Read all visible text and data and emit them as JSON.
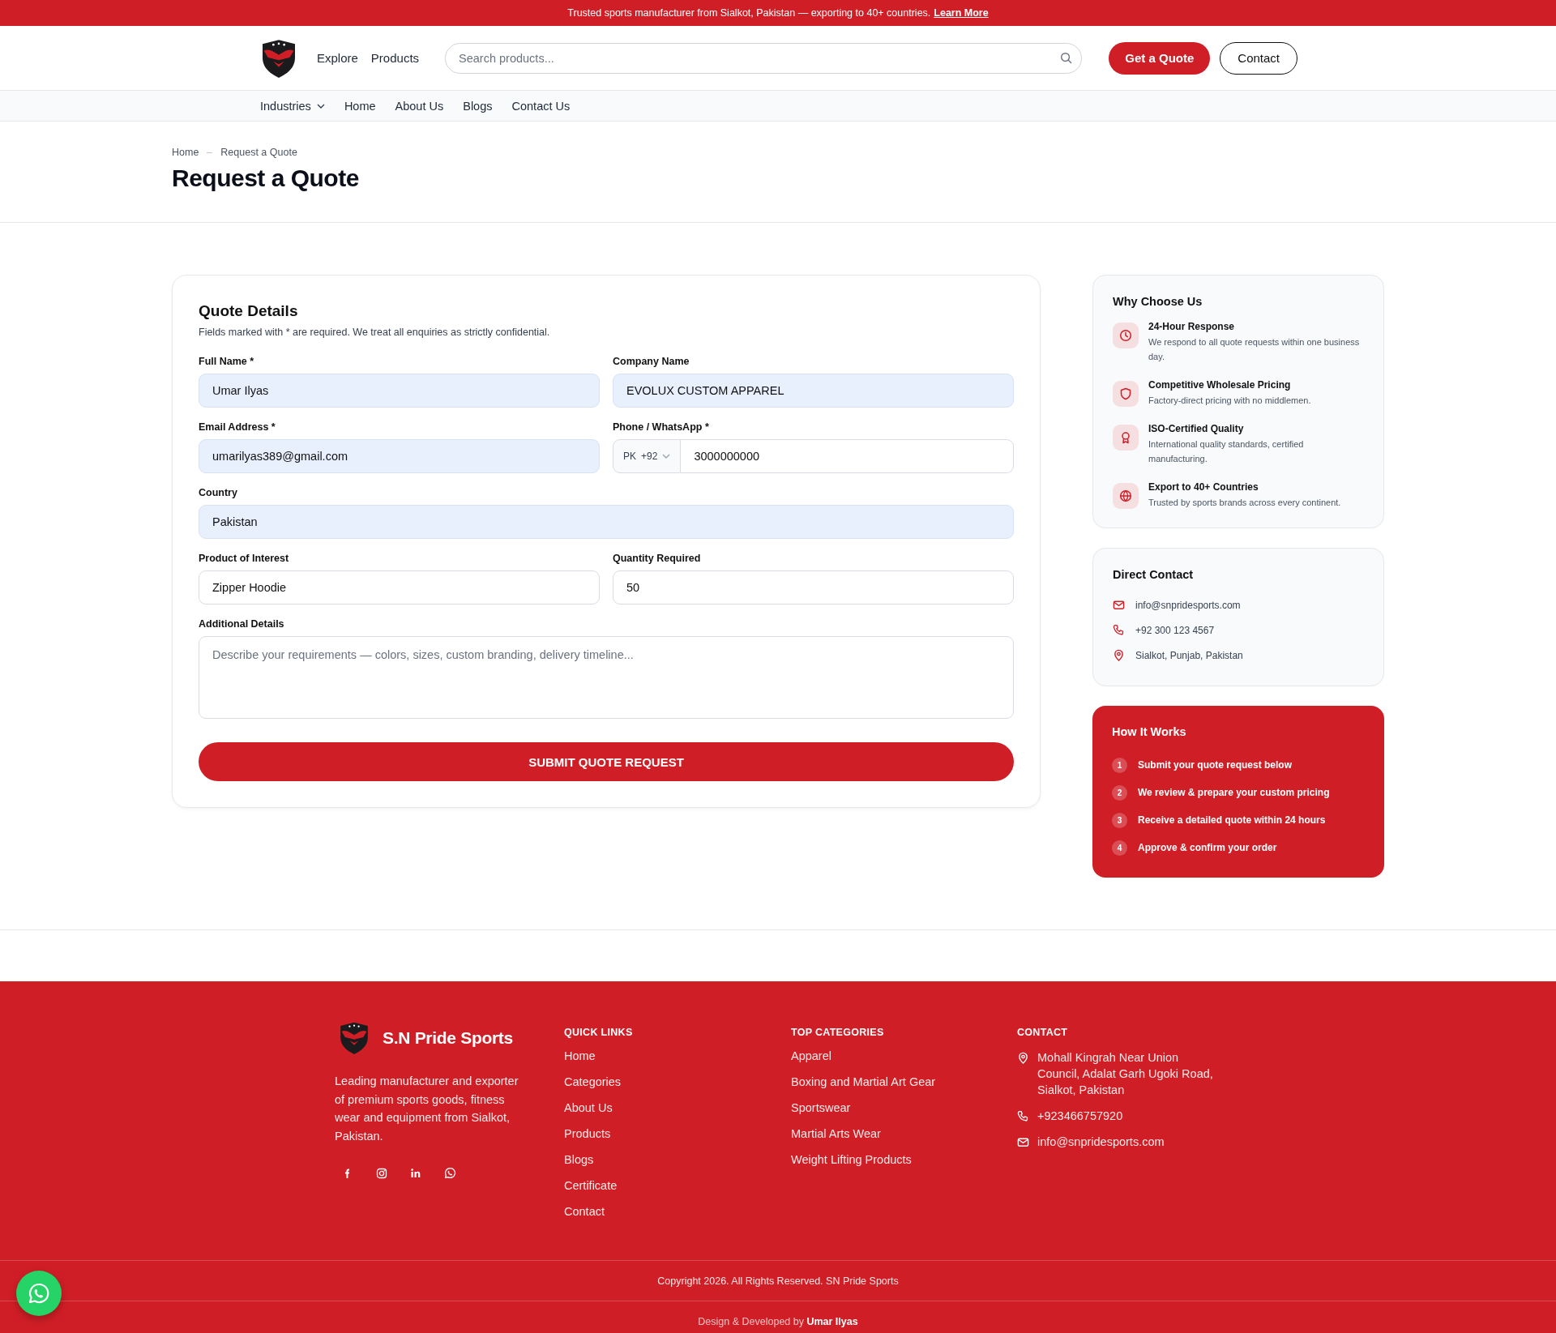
{
  "announcement": {
    "text": "Trusted sports manufacturer from Sialkot, Pakistan — exporting to 40+ countries.",
    "link": "Learn More"
  },
  "header": {
    "nav": [
      "Explore",
      "Products"
    ],
    "search": {
      "placeholder": "Search products..."
    },
    "buttons": [
      {
        "label": "Get a Quote",
        "kind": "primary"
      },
      {
        "label": "Contact",
        "kind": "outline"
      }
    ]
  },
  "menu": [
    {
      "label": "Industries",
      "dropdown": true
    },
    {
      "label": "Home",
      "dropdown": false
    },
    {
      "label": "About Us",
      "dropdown": false
    },
    {
      "label": "Blogs",
      "dropdown": false
    },
    {
      "label": "Contact Us",
      "dropdown": false
    }
  ],
  "breadcrumb": [
    "Home",
    "Request a Quote"
  ],
  "page_title": "Request a Quote",
  "form": {
    "title": "Quote Details",
    "note": "Fields marked with * are required. We treat all enquiries as strictly confidential.",
    "rows": [
      [
        {
          "label": "Full Name *",
          "kind": "text",
          "value": "Umar Ilyas",
          "autofilled": true
        },
        {
          "label": "Company Name",
          "kind": "text",
          "value": "EVOLUX CUSTOM APPAREL",
          "autofilled": true
        }
      ],
      [
        {
          "label": "Email Address *",
          "kind": "text",
          "value": "umarilyas389@gmail.com",
          "autofilled": true
        },
        {
          "label": "Phone / WhatsApp *",
          "kind": "phone",
          "country": "PK",
          "dial_code": "+92",
          "value": "3000000000",
          "autofilled": false
        }
      ],
      [
        {
          "label": "Country",
          "kind": "text",
          "value": "Pakistan",
          "autofilled": true
        }
      ],
      [
        {
          "label": "Product of Interest",
          "kind": "text",
          "value": "Zipper Hoodie",
          "autofilled": false
        },
        {
          "label": "Quantity Required",
          "kind": "text",
          "value": "50",
          "autofilled": false
        }
      ],
      [
        {
          "label": "Additional Details",
          "kind": "textarea",
          "placeholder": "Describe your requirements — colors, sizes, custom branding, delivery timeline..."
        }
      ]
    ],
    "submit": "SUBMIT QUOTE REQUEST"
  },
  "why_choose_us": {
    "title": "Why Choose Us",
    "items": [
      {
        "title": "24-Hour Response",
        "text": "We respond to all quote requests within one business day."
      },
      {
        "title": "Competitive Wholesale Pricing",
        "text": "Factory-direct pricing with no middlemen."
      },
      {
        "title": "ISO-Certified Quality",
        "text": "International quality standards, certified manufacturing."
      },
      {
        "title": "Export to 40+ Countries",
        "text": "Trusted by sports brands across every continent."
      }
    ]
  },
  "direct_contact": {
    "title": "Direct Contact",
    "items": [
      "info@snpridesports.com",
      "+92 300 123 4567",
      "Sialkot, Punjab, Pakistan"
    ]
  },
  "how_it_works": {
    "title": "How It Works",
    "steps": [
      {
        "number": "1",
        "text": "Submit your quote request below"
      },
      {
        "number": "2",
        "text": "We review & prepare your custom pricing"
      },
      {
        "number": "3",
        "text": "Receive a detailed quote within 24 hours"
      },
      {
        "number": "4",
        "text": "Approve & confirm your order"
      }
    ]
  },
  "footer": {
    "brand": "S.N Pride Sports",
    "description": "Leading manufacturer and exporter of premium sports goods, fitness wear and equipment from Sialkot, Pakistan.",
    "columns": [
      {
        "title": "QUICK LINKS",
        "links": [
          "Home",
          "Categories",
          "About Us",
          "Products",
          "Blogs",
          "Certificate",
          "Contact"
        ]
      },
      {
        "title": "TOP CATEGORIES",
        "links": [
          "Apparel",
          "Boxing and Martial Art Gear",
          "Sportswear",
          "Martial Arts Wear",
          "Weight Lifting Products"
        ]
      }
    ],
    "contact": {
      "title": "CONTACT",
      "items": [
        "Mohall Kingrah Near Union Council, Adalat Garh Ugoki Road, Sialkot, Pakistan",
        "+923466757920",
        "info@snpridesports.com"
      ]
    },
    "copyright": "Copyright 2026. All Rights Reserved. SN Pride Sports",
    "credit": "Design & Developed by **Umar Ilyas**"
  }
}
